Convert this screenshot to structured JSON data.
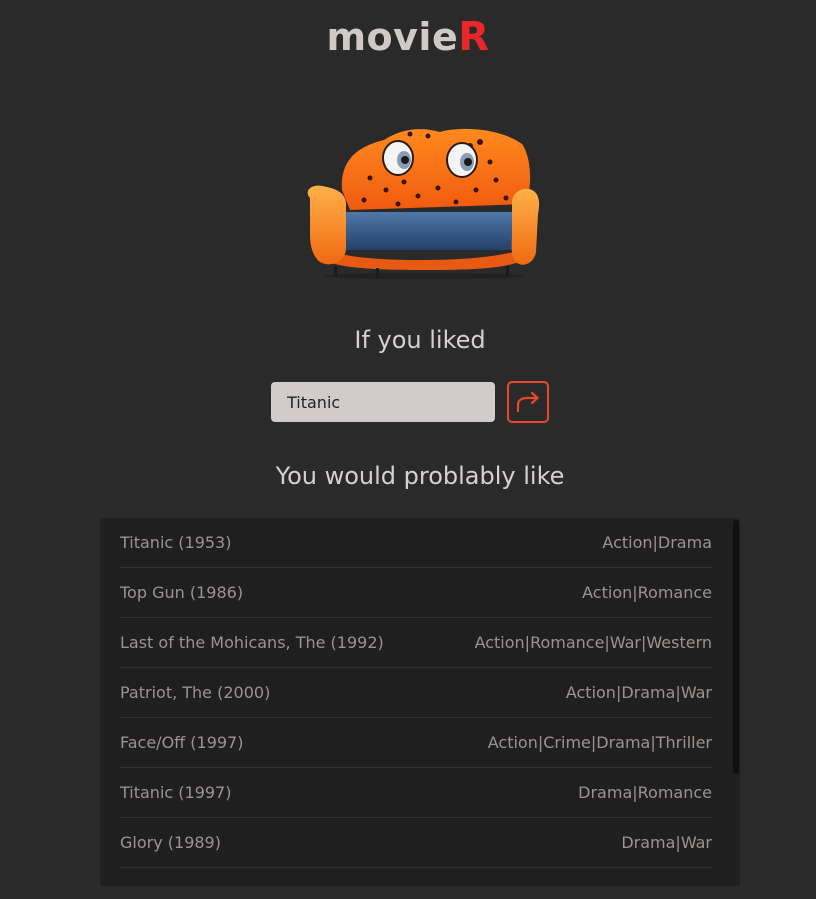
{
  "header": {
    "logo_main": "movie",
    "logo_accent": "R",
    "accent_color": "#e8262b"
  },
  "mascot": {
    "icon": "orange-sofa-with-eyes-illustration"
  },
  "query": {
    "heading": "If you liked",
    "value": "Titanic",
    "submit_icon": "arrow-forward-icon"
  },
  "results": {
    "heading": "You would problably like",
    "items": [
      {
        "title": "Titanic (1953)",
        "genres": "Action|Drama"
      },
      {
        "title": "Top Gun (1986)",
        "genres": "Action|Romance"
      },
      {
        "title": "Last of the Mohicans, The (1992)",
        "genres": "Action|Romance|War|Western"
      },
      {
        "title": "Patriot, The (2000)",
        "genres": "Action|Drama|War"
      },
      {
        "title": "Face/Off (1997)",
        "genres": "Action|Crime|Drama|Thriller"
      },
      {
        "title": "Titanic (1997)",
        "genres": "Drama|Romance"
      },
      {
        "title": "Glory (1989)",
        "genres": "Drama|War"
      }
    ]
  }
}
